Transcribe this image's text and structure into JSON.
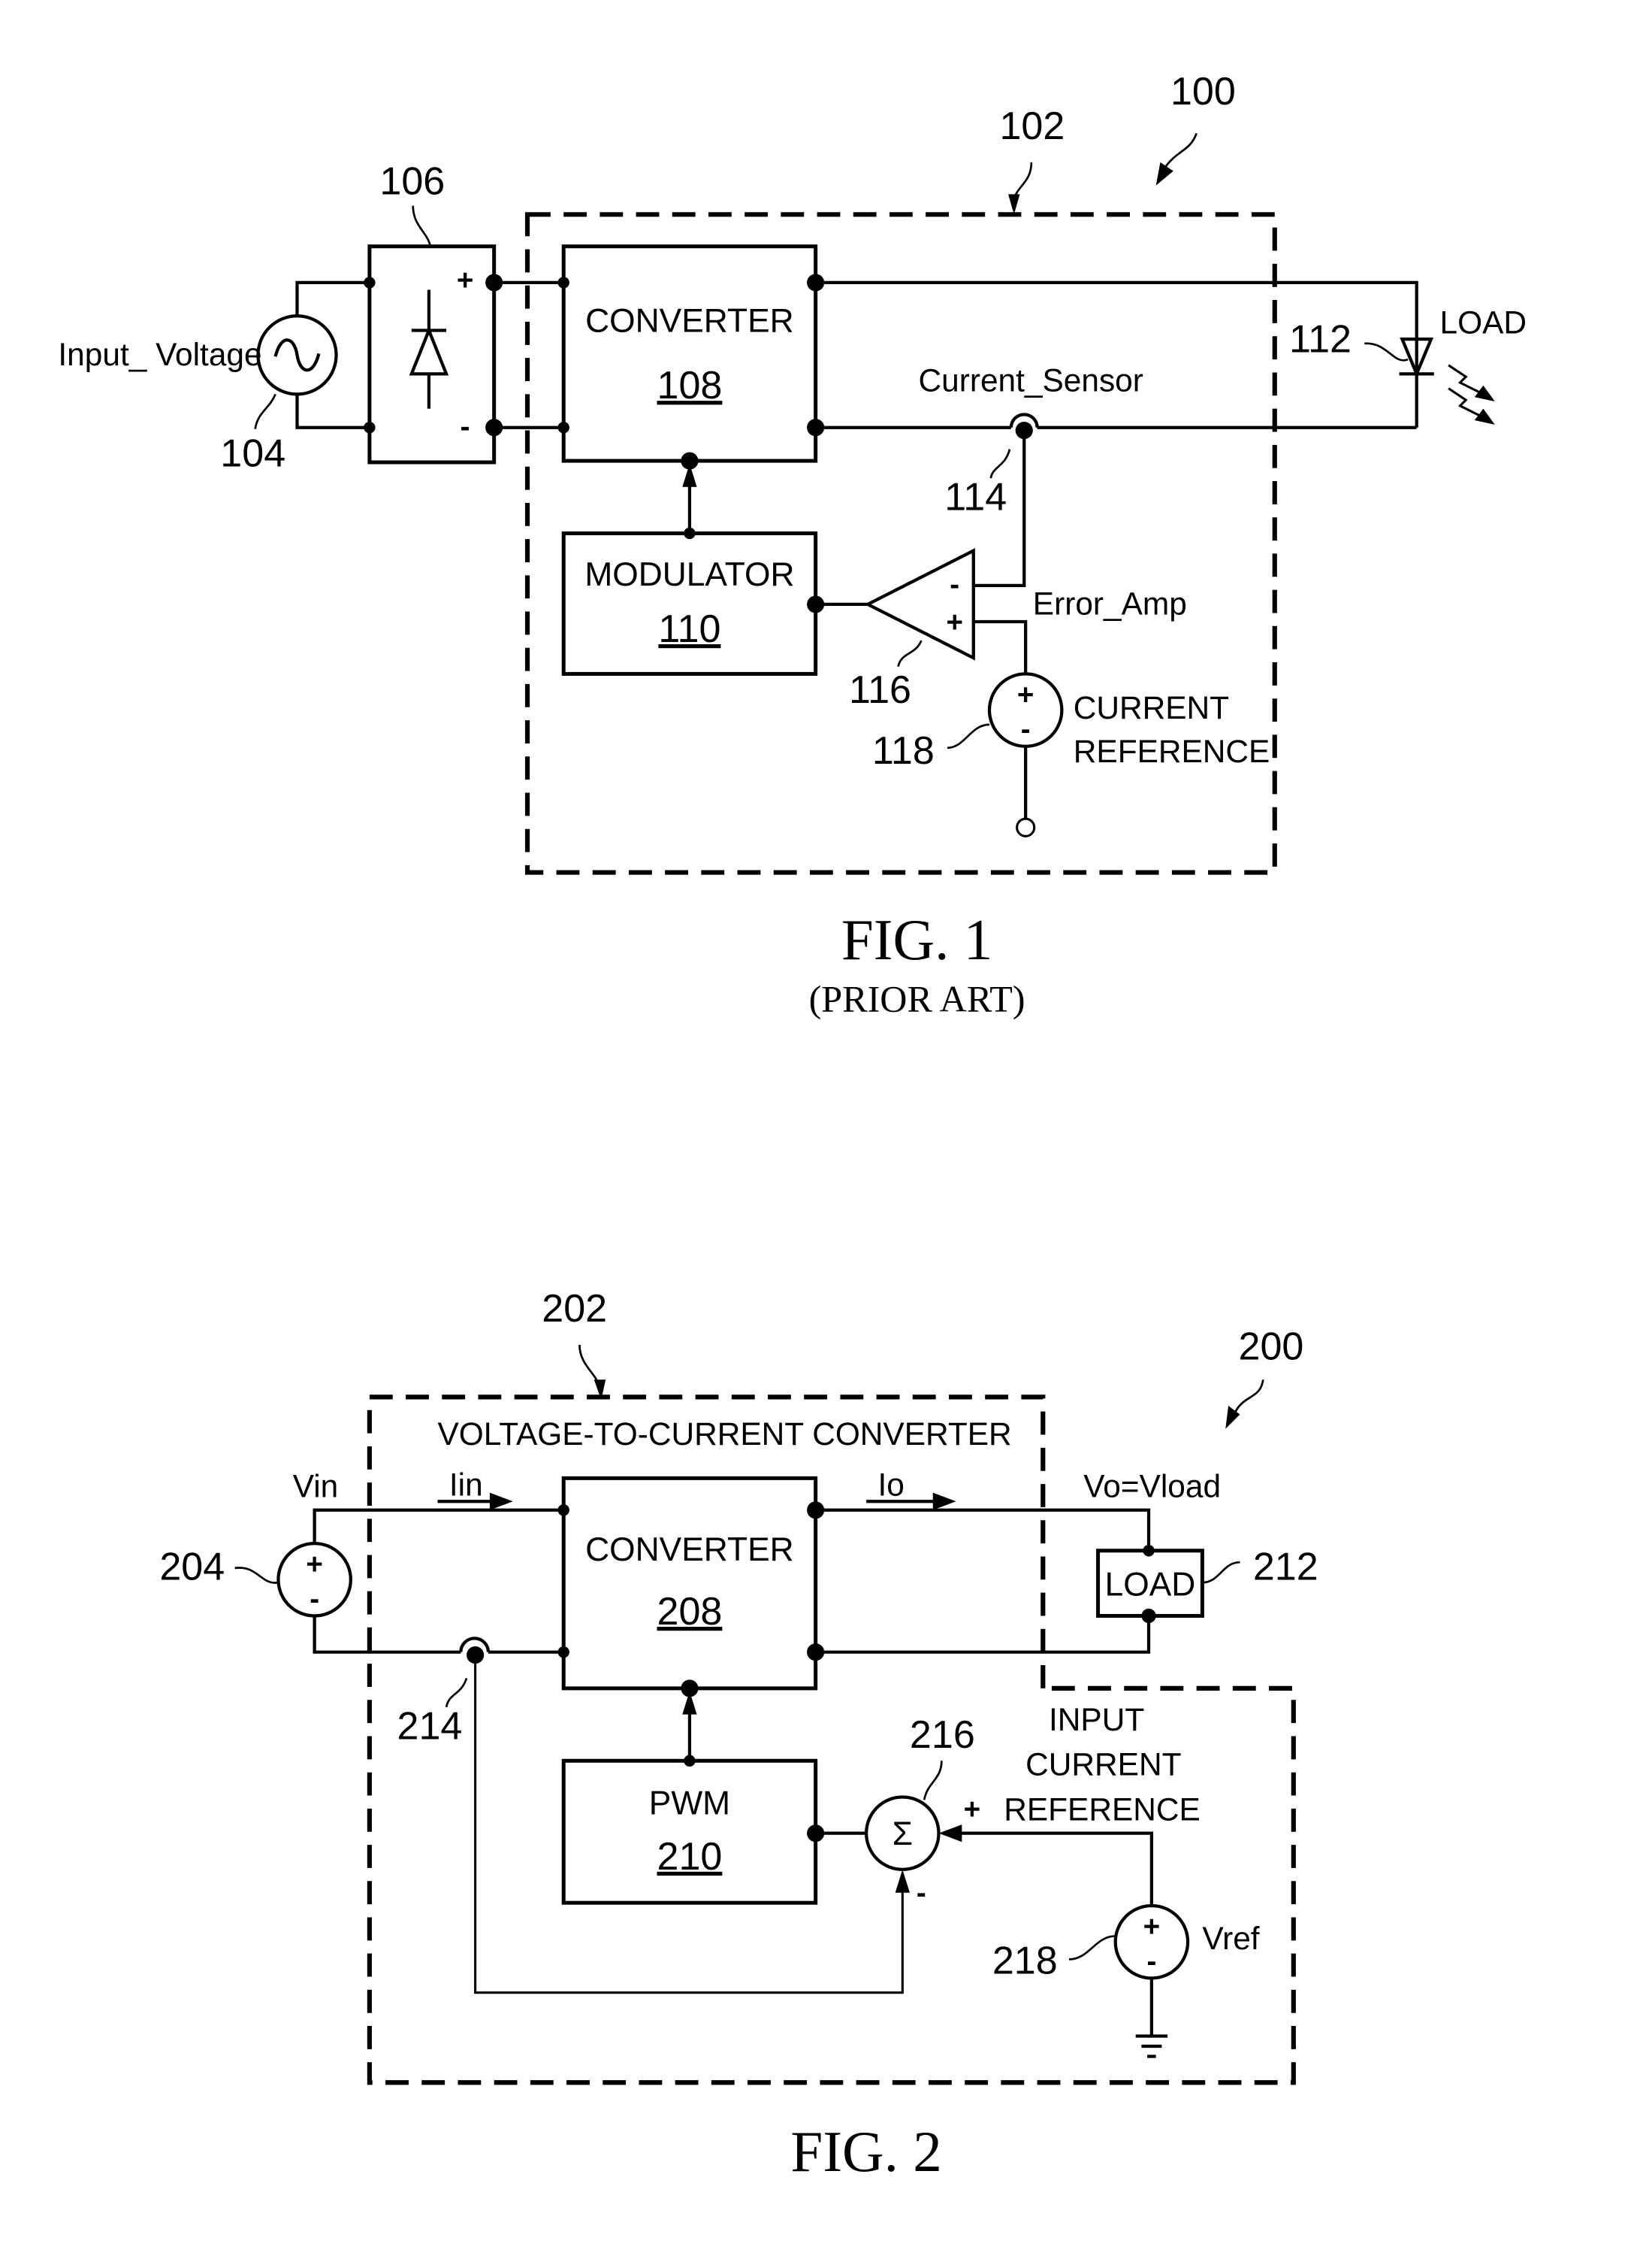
{
  "fig1": {
    "ref_system": "100",
    "ref_controller": "102",
    "ref_input_source": "104",
    "ref_rectifier": "106",
    "ref_load": "112",
    "ref_current_sensor": "114",
    "ref_error_amp": "116",
    "ref_current_reference": "118",
    "input_label": "Input_ Voltage",
    "rect_plus": "+",
    "rect_minus": "-",
    "converter": {
      "title": "CONVERTER",
      "number": "108"
    },
    "modulator": {
      "title": "MODULATOR",
      "number": "110"
    },
    "current_sensor_label": "Current_Sensor",
    "load_label": "LOAD",
    "error_amp_label": "Error_Amp",
    "amp_minus": "-",
    "amp_plus": "+",
    "current_ref_line1": "CURRENT",
    "current_ref_line2": "REFERENCE",
    "src_plus": "+",
    "src_minus": "-",
    "caption": "FIG. 1",
    "caption_sub": "(PRIOR ART)"
  },
  "fig2": {
    "ref_system": "200",
    "ref_converter_block": "202",
    "ref_vin_source": "204",
    "ref_load": "212",
    "ref_sensor": "214",
    "ref_summer": "216",
    "ref_vref_source": "218",
    "block_title": "VOLTAGE-TO-CURRENT CONVERTER",
    "vin_label": "Vin",
    "iin_label": "Iin",
    "io_label": "Io",
    "vo_label": "Vo=Vload",
    "load_label": "LOAD",
    "converter": {
      "title": "CONVERTER",
      "number": "208"
    },
    "pwm": {
      "title": "PWM",
      "number": "210"
    },
    "summer_symbol": "Σ",
    "sum_plus": "+",
    "sum_minus": "-",
    "input_ref_line1": "INPUT",
    "input_ref_line2": "CURRENT",
    "input_ref_line3": "REFERENCE",
    "vref_label": "Vref",
    "src_plus": "+",
    "src_minus": "-",
    "caption": "FIG. 2"
  }
}
